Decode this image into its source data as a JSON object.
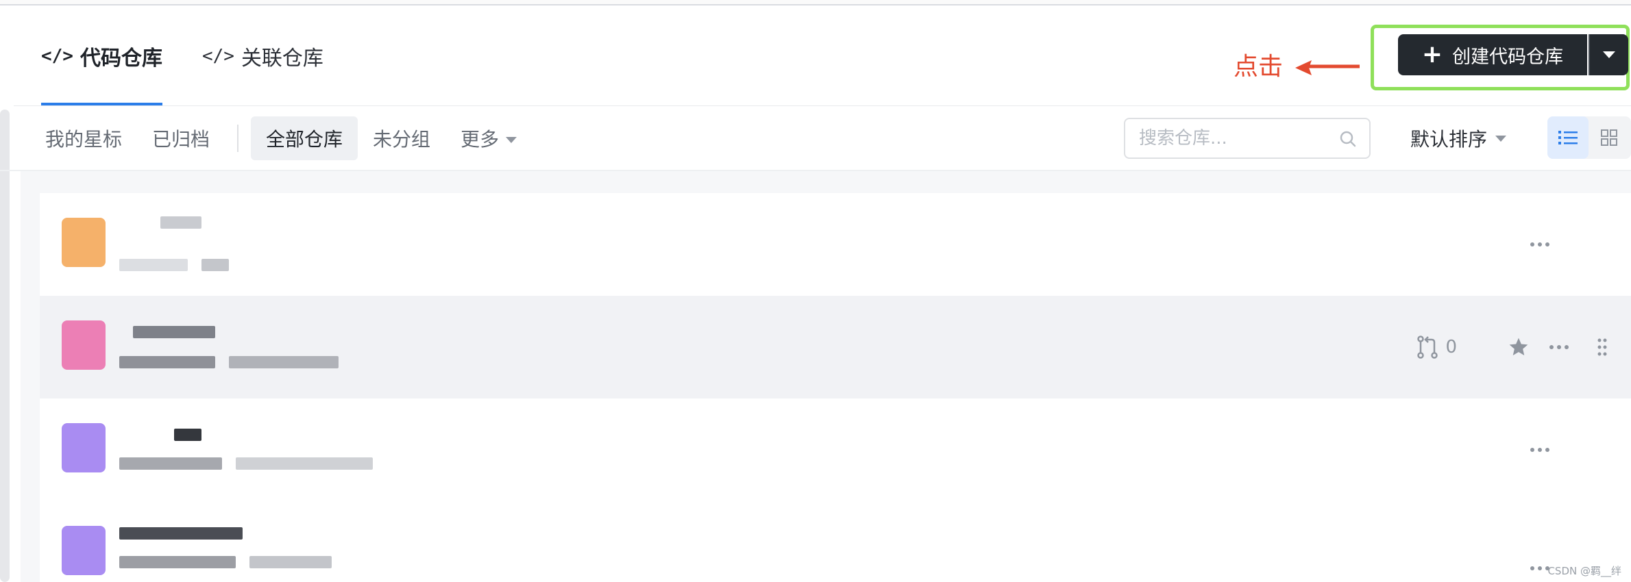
{
  "tabs": [
    {
      "icon": "</>",
      "label": "代码仓库",
      "active": true
    },
    {
      "icon": "</>",
      "label": "关联仓库",
      "active": false
    }
  ],
  "annotation": {
    "text": "点击",
    "color": "#e34a2f",
    "highlight_color": "#8fe05a"
  },
  "create_button": {
    "label": "创建代码仓库",
    "plus": "+"
  },
  "filters": {
    "left": [
      "我的星标",
      "已归档"
    ],
    "right": [
      "全部仓库",
      "未分组"
    ],
    "more": "更多",
    "active": "全部仓库"
  },
  "search": {
    "placeholder": "搜索仓库..."
  },
  "sort": {
    "label": "默认排序"
  },
  "view": {
    "active": "list",
    "accent": "#2b7de9"
  },
  "repos": [
    {
      "avatar_color": "#f5b16a",
      "hovered": false,
      "merge_requests": ""
    },
    {
      "avatar_color": "#ec7fb5",
      "hovered": true,
      "merge_requests": "0"
    },
    {
      "avatar_color": "#a98cf2",
      "hovered": false,
      "merge_requests": ""
    },
    {
      "avatar_color": "#a98cf2",
      "hovered": false,
      "merge_requests": ""
    }
  ],
  "watermark": "CSDN @羁__绊"
}
